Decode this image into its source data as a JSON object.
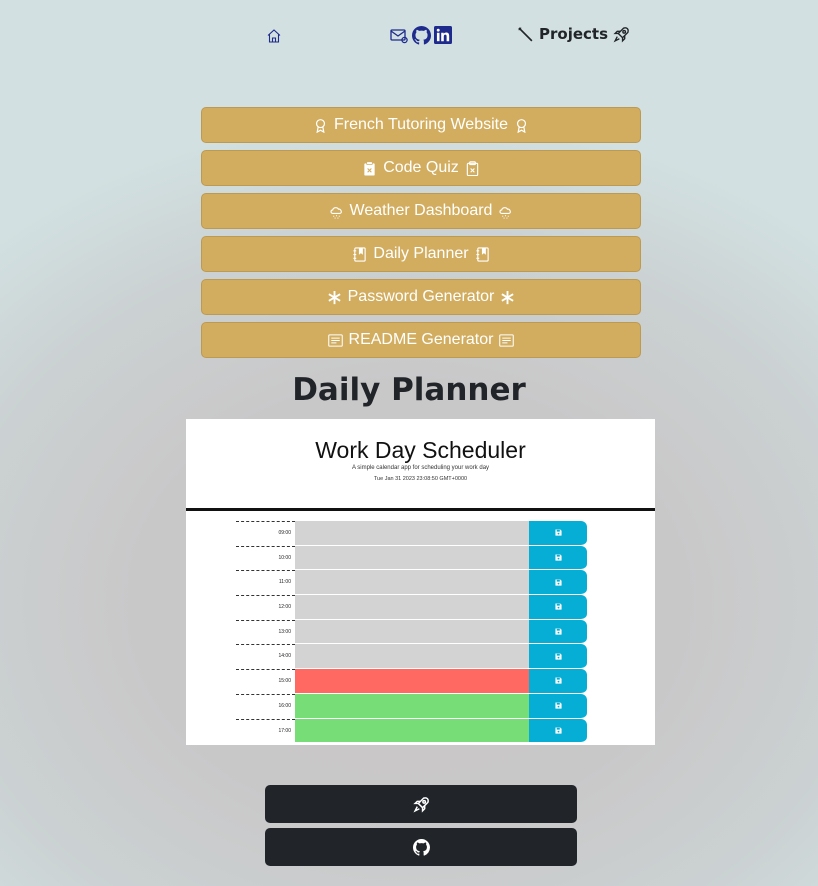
{
  "nav": {
    "home_icon": "house-icon",
    "social_icons": [
      "envelope-at-icon",
      "github-icon",
      "linkedin-icon"
    ],
    "projects_label": "Projects",
    "projects_icon_left": "wand-icon",
    "projects_icon_right": "rocket-icon"
  },
  "projects": [
    {
      "label": "French Tutoring Website",
      "icon": "award-icon"
    },
    {
      "label": "Code Quiz",
      "icon": "clipboard-x-icon"
    },
    {
      "label": "Weather Dashboard",
      "icon": "cloud-snow-icon"
    },
    {
      "label": "Daily Planner",
      "icon": "journal-bookmark-icon"
    },
    {
      "label": "Password Generator",
      "icon": "asterisk-icon"
    },
    {
      "label": "README Generator",
      "icon": "card-text-icon"
    }
  ],
  "section_title": "Daily Planner",
  "preview": {
    "title": "Work Day Scheduler",
    "subtitle": "A simple calendar app for scheduling your work day",
    "date": "Tue Jan 31 2023 23:08:50 GMT+0000",
    "rows": [
      {
        "hour": "09:00",
        "state": "past"
      },
      {
        "hour": "10:00",
        "state": "past"
      },
      {
        "hour": "11:00",
        "state": "past"
      },
      {
        "hour": "12:00",
        "state": "past"
      },
      {
        "hour": "13:00",
        "state": "past"
      },
      {
        "hour": "14:00",
        "state": "past"
      },
      {
        "hour": "15:00",
        "state": "present"
      },
      {
        "hour": "16:00",
        "state": "future"
      },
      {
        "hour": "17:00",
        "state": "future"
      }
    ]
  },
  "colors": {
    "accent_gold": "#d2ad5f",
    "past": "#d3d3d3",
    "present": "#ff6961",
    "future": "#77dd77",
    "save": "#06aed5",
    "dark_button": "#212529"
  },
  "bottom_buttons": [
    {
      "icon": "rocket-icon",
      "name": "deployed-app-button"
    },
    {
      "icon": "github-icon",
      "name": "github-repo-button"
    }
  ]
}
